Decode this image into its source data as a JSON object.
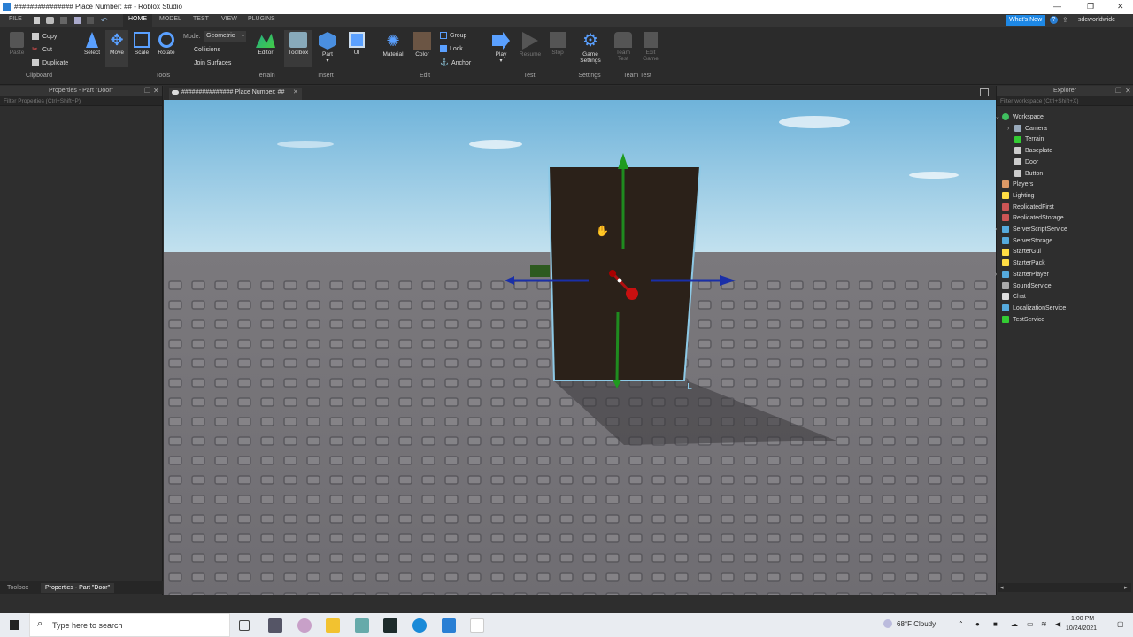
{
  "window": {
    "title": "############### Place Number: ## - Roblox Studio",
    "controls": [
      "—",
      "❐",
      "✕"
    ]
  },
  "menubar": {
    "file": "FILE",
    "tabs": [
      "HOME",
      "MODEL",
      "TEST",
      "VIEW",
      "PLUGINS"
    ],
    "whats_new": "What's New",
    "username": "sdcworldwide"
  },
  "ribbon": {
    "clipboard": {
      "paste": "Paste",
      "copy": "Copy",
      "cut": "Cut",
      "duplicate": "Duplicate",
      "group_label": "Clipboard"
    },
    "tools": {
      "select": "Select",
      "move": "Move",
      "scale": "Scale",
      "rotate": "Rotate",
      "mode_label": "Mode:",
      "mode_value": "Geometric",
      "collisions": "Collisions",
      "join_surfaces": "Join Surfaces",
      "group_label": "Tools"
    },
    "terrain": {
      "editor": "Editor",
      "group_label": "Terrain"
    },
    "insert": {
      "toolbox": "Toolbox",
      "part": "Part",
      "ui": "UI",
      "group_label": "Insert"
    },
    "edit": {
      "material": "Material",
      "color": "Color",
      "group": "Group",
      "lock": "Lock",
      "anchor": "Anchor",
      "group_label": "Edit"
    },
    "test": {
      "play": "Play",
      "resume": "Resume",
      "stop": "Stop",
      "group_label": "Test"
    },
    "settings": {
      "game_settings": "Game Settings",
      "group_label": "Settings"
    },
    "team_test": {
      "team_test": "Team Test",
      "exit_game": "Exit Game",
      "group_label": "Team Test"
    }
  },
  "properties_panel": {
    "title": "Properties - Part \"Door\"",
    "filter_placeholder": "Filter Properties (Ctrl+Shift+P)"
  },
  "document_tab": {
    "label": "############### Place Number: ##"
  },
  "explorer": {
    "title": "Explorer",
    "filter_placeholder": "Filter workspace (Ctrl+Shift+X)",
    "items": [
      {
        "label": "Workspace",
        "icon": "workspace-icon",
        "color": "#3fbf5f"
      },
      {
        "label": "Camera",
        "icon": "camera-icon",
        "color": "#9ab"
      },
      {
        "label": "Terrain",
        "icon": "terrain-icon",
        "color": "#3c3"
      },
      {
        "label": "Baseplate",
        "icon": "part-icon",
        "color": "#ccc"
      },
      {
        "label": "Door",
        "icon": "part-icon",
        "color": "#ccc"
      },
      {
        "label": "Button",
        "icon": "part-icon",
        "color": "#ccc"
      },
      {
        "label": "Players",
        "icon": "players-icon",
        "color": "#d96"
      },
      {
        "label": "Lighting",
        "icon": "lighting-icon",
        "color": "#fd4"
      },
      {
        "label": "ReplicatedFirst",
        "icon": "replicated-first-icon",
        "color": "#c55"
      },
      {
        "label": "ReplicatedStorage",
        "icon": "replicated-storage-icon",
        "color": "#c55"
      },
      {
        "label": "ServerScriptService",
        "icon": "server-script-service-icon",
        "color": "#5ad"
      },
      {
        "label": "ServerStorage",
        "icon": "server-storage-icon",
        "color": "#5ad"
      },
      {
        "label": "StarterGui",
        "icon": "starter-gui-icon",
        "color": "#fd4"
      },
      {
        "label": "StarterPack",
        "icon": "starter-pack-icon",
        "color": "#fd4"
      },
      {
        "label": "StarterPlayer",
        "icon": "starter-player-icon",
        "color": "#5ad"
      },
      {
        "label": "SoundService",
        "icon": "sound-service-icon",
        "color": "#aaa"
      },
      {
        "label": "Chat",
        "icon": "chat-icon",
        "color": "#ddd"
      },
      {
        "label": "LocalizationService",
        "icon": "localization-service-icon",
        "color": "#5ad"
      },
      {
        "label": "TestService",
        "icon": "test-service-icon",
        "color": "#3c3"
      }
    ]
  },
  "bottom_tabs": [
    "Toolbox",
    "Properties - Part \"Door\""
  ],
  "taskbar": {
    "search_placeholder": "Type here to search",
    "weather": "68°F  Cloudy",
    "time": "1:00 PM",
    "date": "10/24/2021"
  }
}
